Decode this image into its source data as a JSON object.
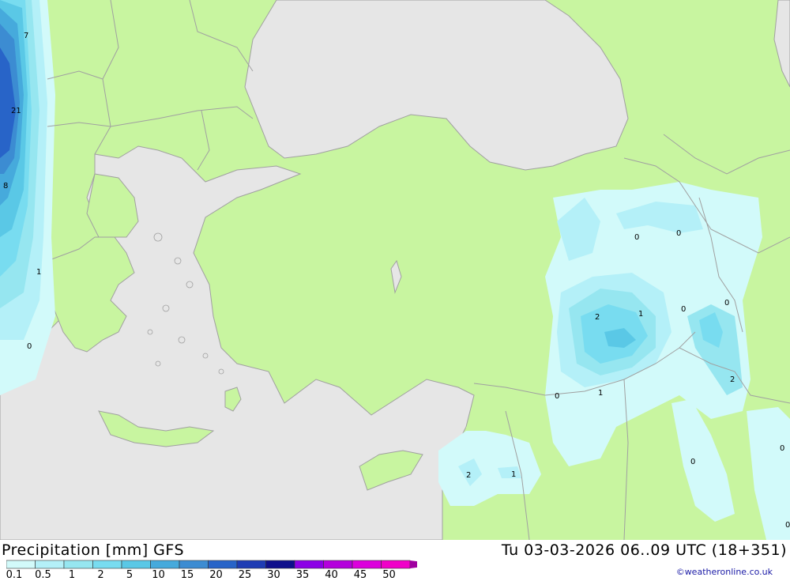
{
  "header": {
    "title": "Precipitation [mm] GFS",
    "valid_time": "Tu 03-03-2026 06..09 UTC (18+351)",
    "credit": "©weatheronline.co.uk"
  },
  "legend": {
    "labels": [
      "0.1",
      "0.5",
      "1",
      "2",
      "5",
      "10",
      "15",
      "20",
      "25",
      "30",
      "35",
      "40",
      "45",
      "50"
    ],
    "colors": [
      "#d2fafa",
      "#b4f0f8",
      "#96e6f0",
      "#78dcf0",
      "#5ac8e6",
      "#46aadc",
      "#3c8cd2",
      "#2864c8",
      "#1e3cb4",
      "#0f0f8c",
      "#8c00e6",
      "#b400dc",
      "#dc00dc",
      "#f000c8",
      "#a000a0"
    ]
  },
  "colors": {
    "land": "#c8f5a0",
    "sea": "#e6e6e6",
    "border": "#a0a0a0"
  },
  "map_labels": [
    {
      "id": "label-7",
      "text": "7"
    },
    {
      "id": "label-21",
      "text": "21"
    },
    {
      "id": "label-8",
      "text": "8"
    },
    {
      "id": "label-1-west",
      "text": "1"
    },
    {
      "id": "label-0-west",
      "text": "0"
    },
    {
      "id": "label-0-ne1",
      "text": "0"
    },
    {
      "id": "label-0-ne2",
      "text": "0"
    },
    {
      "id": "label-2-east",
      "text": "2"
    },
    {
      "id": "label-1-east",
      "text": "1"
    },
    {
      "id": "label-0-east1",
      "text": "0"
    },
    {
      "id": "label-0-east2",
      "text": "0"
    },
    {
      "id": "label-2-se",
      "text": "2"
    },
    {
      "id": "label-0-se",
      "text": "0"
    },
    {
      "id": "label-1-se",
      "text": "1"
    },
    {
      "id": "label-2-levant",
      "text": "2"
    },
    {
      "id": "label-1-levant",
      "text": "1"
    },
    {
      "id": "label-0-south",
      "text": "0"
    },
    {
      "id": "label-0-edge1",
      "text": "0"
    },
    {
      "id": "label-0-edge2",
      "text": "0"
    }
  ]
}
